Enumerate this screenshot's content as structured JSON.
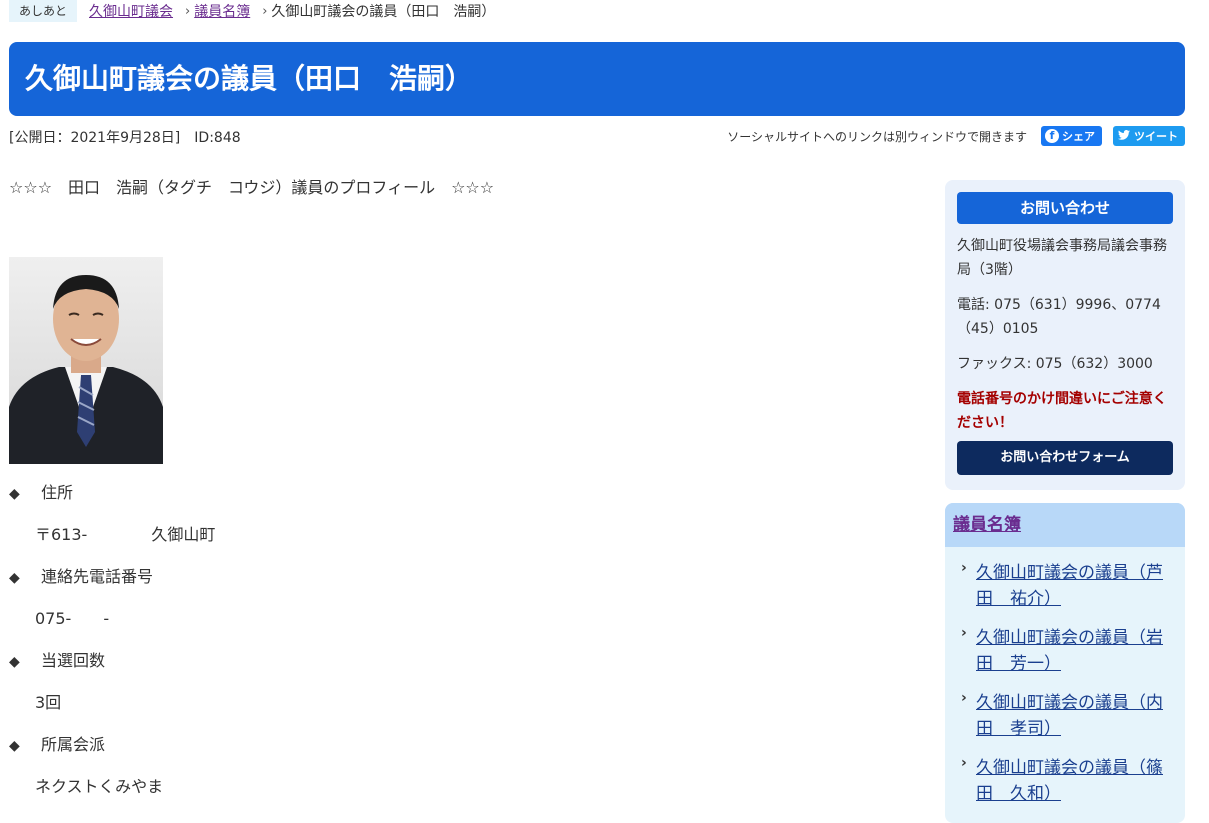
{
  "breadcrumb": {
    "tag": "あしあと",
    "items": [
      "久御山町議会",
      "議員名簿"
    ],
    "current": "久御山町議会の議員（田口　浩嗣）"
  },
  "page_title": "久御山町議会の議員（田口　浩嗣）",
  "meta": {
    "published": "[公開日：2021年9月28日]",
    "id": "ID:848"
  },
  "social": {
    "note": "ソーシャルサイトへのリンクは別ウィンドウで開きます",
    "share_label": "シェア",
    "tweet_label": "ツイート",
    "share_icon": "facebook-icon",
    "tweet_icon": "twitter-bird-icon"
  },
  "profile": {
    "heading": "☆☆☆　田口　浩嗣（タグチ　コウジ）議員のプロフィール　☆☆☆",
    "items": [
      {
        "label": "住所",
        "value": "〒613-　　　　久御山町"
      },
      {
        "label": "連絡先電話番号",
        "value": "075-　　-"
      },
      {
        "label": "当選回数",
        "value": "3回"
      },
      {
        "label": "所属会派",
        "value": "ネクストくみやま"
      }
    ],
    "bullet": "◆"
  },
  "contact": {
    "heading": "お問い合わせ",
    "office": "久御山町役場議会事務局議会事務局（3階）",
    "phone": "電話: 075（631）9996、0774（45）0105",
    "fax": "ファックス: 075（632）3000",
    "warning": "電話番号のかけ間違いにご注意ください！",
    "form_button": "お問い合わせフォーム"
  },
  "members": {
    "heading": "議員名簿",
    "items": [
      "久御山町議会の議員（芦田　祐介）",
      "久御山町議会の議員（岩田　芳一）",
      "久御山町議会の議員（内田　孝司）",
      "久御山町議会の議員（篠田　久和）"
    ]
  },
  "colors": {
    "title_bg": "#1565d8",
    "link_visited": "#6a2c8f",
    "warning": "#a40000",
    "form_button_bg": "#0d2a5e"
  }
}
